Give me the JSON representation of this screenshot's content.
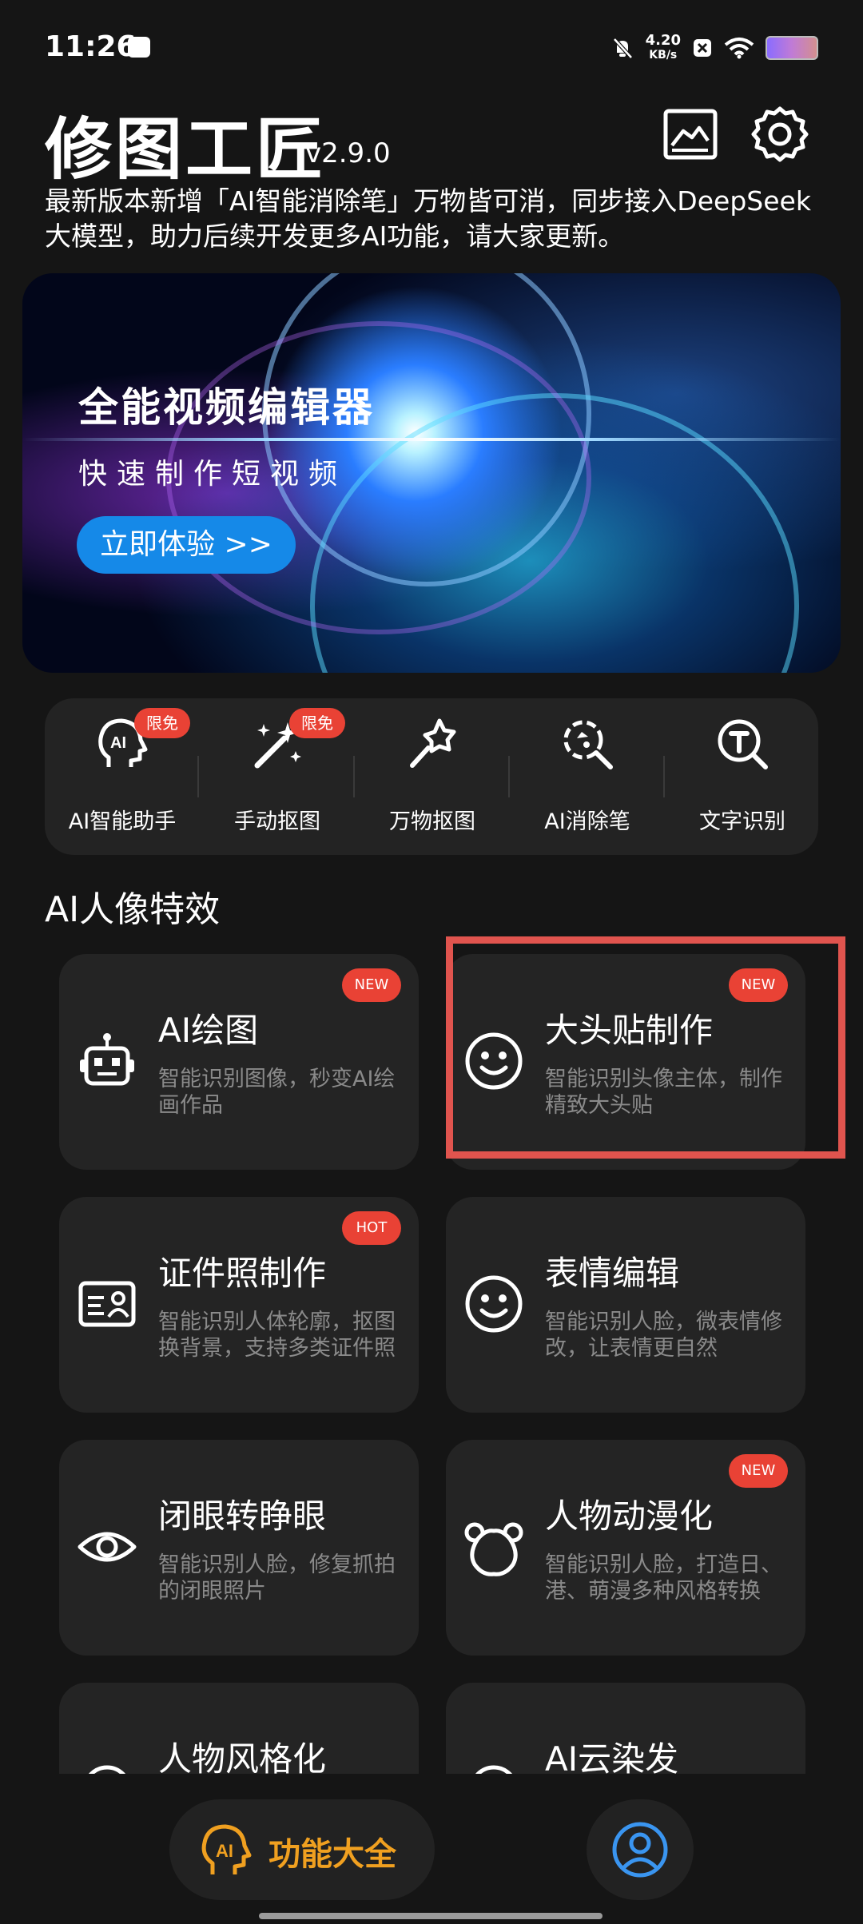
{
  "status": {
    "time": "11:26",
    "net_speed_value": "4.20",
    "net_speed_unit": "KB/s"
  },
  "header": {
    "title": "修图工匠",
    "version": "v2.9.0",
    "description": "最新版本新增「AI智能消除笔」万物皆可消，同步接入DeepSeek大模型，助力后续开发更多AI功能，请大家更新。"
  },
  "banner": {
    "title": "全能视频编辑器",
    "subtitle": "快速制作短视频",
    "button": "立即体验 >>"
  },
  "tools": [
    {
      "label": "AI智能助手",
      "badge": "限免",
      "icon": "ai-head-icon"
    },
    {
      "label": "手动抠图",
      "badge": "限免",
      "icon": "magic-wand-icon"
    },
    {
      "label": "万物抠图",
      "badge": "",
      "icon": "pin-wand-icon"
    },
    {
      "label": "AI消除笔",
      "badge": "",
      "icon": "scan-search-icon"
    },
    {
      "label": "文字识别",
      "badge": "",
      "icon": "text-search-icon"
    }
  ],
  "section": {
    "title": "AI人像特效"
  },
  "cards": [
    {
      "title": "AI绘图",
      "desc": "智能识别图像，秒变AI绘画作品",
      "badge": "NEW",
      "icon": "robot-icon"
    },
    {
      "title": "大头贴制作",
      "desc": "智能识别头像主体，制作精致大头贴",
      "badge": "NEW",
      "icon": "smile-icon"
    },
    {
      "title": "证件照制作",
      "desc": "智能识别人体轮廓，抠图换背景，支持多类证件照",
      "badge": "HOT",
      "icon": "id-card-icon"
    },
    {
      "title": "表情编辑",
      "desc": "智能识别人脸，微表情修改，让表情更自然",
      "badge": "",
      "icon": "smile-icon"
    },
    {
      "title": "闭眼转睁眼",
      "desc": "智能识别人脸，修复抓拍的闭眼照片",
      "badge": "",
      "icon": "eye-icon"
    },
    {
      "title": "人物动漫化",
      "desc": "智能识别人脸，打造日、港、萌漫多种风格转换",
      "badge": "NEW",
      "icon": "bear-icon"
    },
    {
      "title": "人物风格化",
      "desc": "",
      "badge": "",
      "icon": "style-icon"
    },
    {
      "title": "AI云染发",
      "desc": "",
      "badge": "",
      "icon": "hair-icon"
    }
  ],
  "nav": {
    "main_label": "功能大全"
  },
  "colors": {
    "accent_orange": "#f0a020",
    "badge_red": "#e94235",
    "banner_button": "#1589e8",
    "highlight": "#e0544e",
    "profile_blue": "#3a95f0"
  }
}
